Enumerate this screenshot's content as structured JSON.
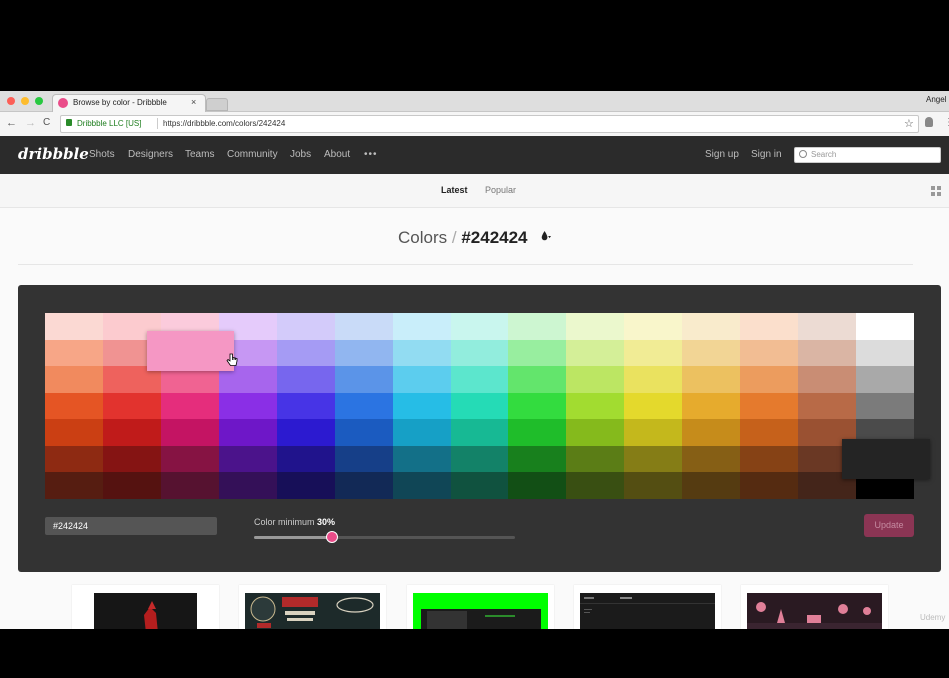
{
  "browser": {
    "tab_title": "Browse by color - Dribbble",
    "tab_close": "×",
    "user_name": "Angel",
    "back": "←",
    "forward": "→",
    "reload": "C",
    "secure_label": "Dribbble LLC [US]",
    "url": "https://dribbble.com/colors/242424",
    "bookmark_star": "☆",
    "menu": "⋮"
  },
  "site": {
    "logo": "dribbble",
    "nav": [
      "Shots",
      "Designers",
      "Teams",
      "Community",
      "Jobs",
      "About",
      "•••"
    ],
    "sign_up": "Sign up",
    "sign_in": "Sign in",
    "search_placeholder": "Search"
  },
  "subnav": {
    "latest": "Latest",
    "popular": "Popular"
  },
  "page": {
    "heading_prefix": "Colors",
    "heading_sep": "/",
    "heading_hex": "#242424",
    "hex_input_value": "#242424",
    "color_minimum_label": "Color minimum",
    "color_minimum_value": "30%",
    "color_minimum_fraction": 0.3,
    "update_label": "Update",
    "watermark": "Udemy"
  },
  "palette": {
    "columns": [
      [
        "#fbd9d3",
        "#f7a687",
        "#f18a5e",
        "#e55524",
        "#cb3f13",
        "#8e2a12",
        "#561d11"
      ],
      [
        "#fccbcf",
        "#f09392",
        "#ee625d",
        "#e2332e",
        "#c01b1a",
        "#851413",
        "#551210"
      ],
      [
        "#fbcbdc",
        "#f597b9",
        "#f06392",
        "#e52d7c",
        "#c41463",
        "#861343",
        "#561230"
      ],
      [
        "#e5cbfb",
        "#c697f3",
        "#a765ed",
        "#8a2fe6",
        "#6e17c8",
        "#4b138b",
        "#341058"
      ],
      [
        "#d3cbfa",
        "#a59bf4",
        "#7766ee",
        "#4734e6",
        "#2c1ad0",
        "#20138c",
        "#170f58"
      ],
      [
        "#c9dbf8",
        "#91b6f0",
        "#5b94e8",
        "#2b74e2",
        "#1b5bc0",
        "#163f88",
        "#122956"
      ],
      [
        "#c9eefa",
        "#92dcf2",
        "#5ccdee",
        "#26bde6",
        "#16a0c6",
        "#137088",
        "#104656"
      ],
      [
        "#c9f6ee",
        "#92eddd",
        "#5ce6cd",
        "#25dbb6",
        "#17b994",
        "#138268",
        "#10523f"
      ],
      [
        "#cdf6d1",
        "#98ee9f",
        "#63e56c",
        "#33dc3f",
        "#1fbd2a",
        "#18801d",
        "#124f15"
      ],
      [
        "#ebf8cd",
        "#d4ef98",
        "#bce663",
        "#a2dc30",
        "#85ba1c",
        "#5b7d16",
        "#394f12"
      ],
      [
        "#f9f6cb",
        "#f1ec95",
        "#eae25f",
        "#e4d92c",
        "#c4b81c",
        "#857d16",
        "#544e12"
      ],
      [
        "#f9ebcc",
        "#f2d595",
        "#ecc160",
        "#e6ab2d",
        "#c68c1b",
        "#865f15",
        "#553b11"
      ],
      [
        "#fbdfcc",
        "#f2bd93",
        "#ec9c5e",
        "#e57a2d",
        "#c6611b",
        "#864215",
        "#552b11"
      ],
      [
        "#ecdbd3",
        "#dab5a4",
        "#c98d74",
        "#b86a47",
        "#9a5132",
        "#6a3824",
        "#44251a"
      ],
      [
        "#ffffff",
        "#dcdcdc",
        "#a9a9a9",
        "#7b7b7b",
        "#4b4b4b",
        "#242424",
        "#000000"
      ]
    ],
    "hover_color": "#f597c4",
    "selected_color": "#242424"
  },
  "thumbnails": [
    {
      "name": "shot-red-fox",
      "bg": "#161616"
    },
    {
      "name": "shot-deus",
      "bg": "#1d2a2a"
    },
    {
      "name": "shot-green",
      "bg": "#00ff00"
    },
    {
      "name": "shot-dark-site",
      "bg": "#1b1b1b"
    },
    {
      "name": "shot-pink-landscape",
      "bg": "#2a1a22"
    }
  ]
}
